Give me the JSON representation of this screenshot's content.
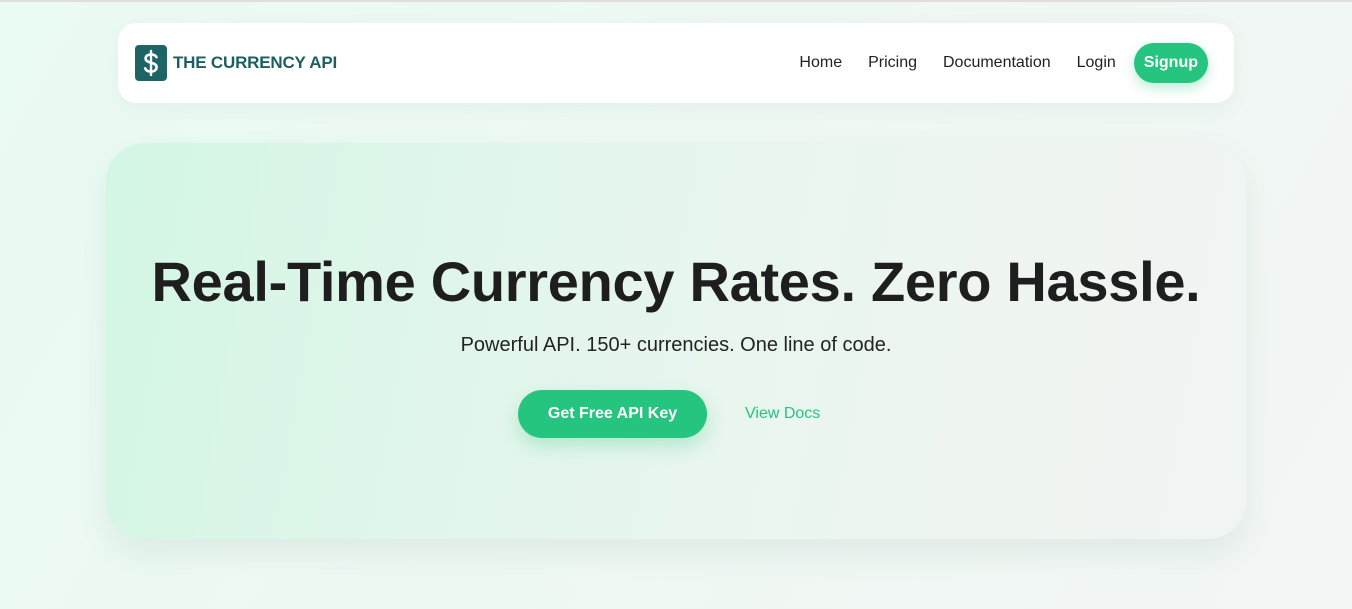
{
  "colors": {
    "accent": "#25c47f",
    "brand": "#1f6464",
    "text": "#1e1e1e"
  },
  "brand": {
    "logo_icon": "dollar-sign-icon",
    "name": "THE CURRENCY API"
  },
  "nav": {
    "links": [
      {
        "label": "Home"
      },
      {
        "label": "Pricing"
      },
      {
        "label": "Documentation"
      },
      {
        "label": "Login"
      }
    ],
    "signup_label": "Signup"
  },
  "hero": {
    "title": "Real-Time Currency Rates. Zero Hassle.",
    "subtitle": "Powerful API. 150+ currencies. One line of code.",
    "primary_cta": "Get Free API Key",
    "secondary_cta": "View Docs"
  }
}
